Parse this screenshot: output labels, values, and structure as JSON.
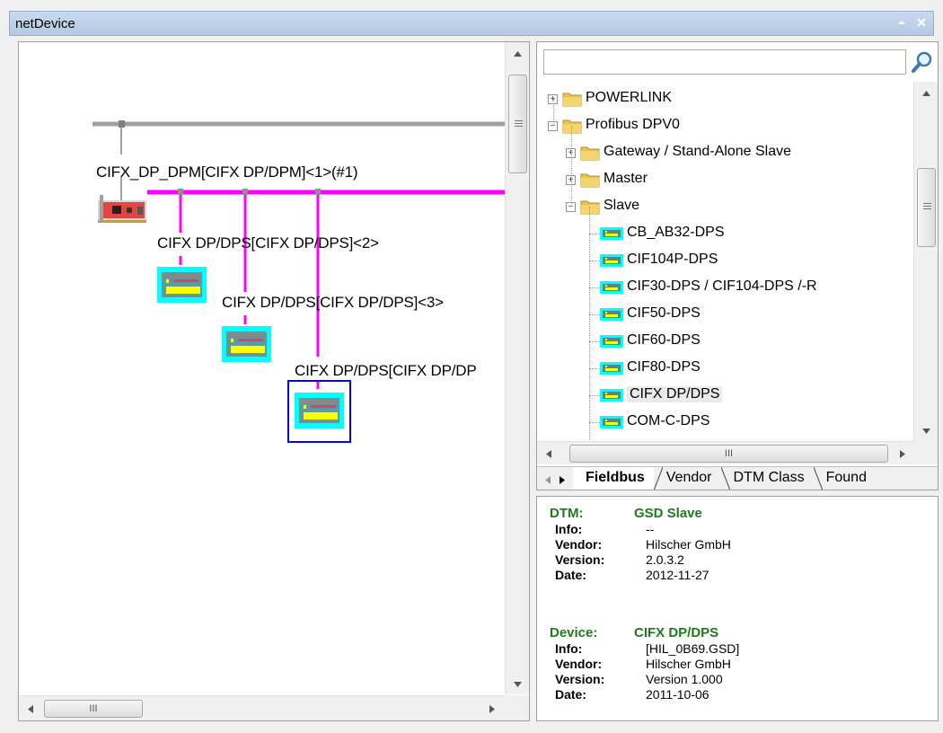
{
  "window": {
    "title": "netDevice"
  },
  "diagram": {
    "master_label": "CIFX_DP_DPM[CIFX DP/DPM]<1>(#1)",
    "slaves": [
      {
        "label": "CIFX DP/DPS[CIFX DP/DPS]<2>"
      },
      {
        "label": "CIFX DP/DPS[CIFX DP/DPS]<3>"
      },
      {
        "label": "CIFX DP/DPS[CIFX DP/DP"
      }
    ],
    "colors": {
      "bus_gray": "#a0a0a0",
      "bus_magenta": "#ff00ff",
      "device_cyan": "#00ffff",
      "selection_blue": "#0000ff"
    }
  },
  "scrollbars": {
    "h_grip": "III"
  },
  "catalog": {
    "search_value": "",
    "search_icon": "magnifier-icon",
    "tree": [
      {
        "label": "POWERLINK",
        "type": "folder",
        "level": 0,
        "expander": "+"
      },
      {
        "label": "Profibus DPV0",
        "type": "folder",
        "level": 0,
        "expander": "-"
      },
      {
        "label": "Gateway / Stand-Alone Slave",
        "type": "folder",
        "level": 1,
        "expander": "+"
      },
      {
        "label": "Master",
        "type": "folder",
        "level": 1,
        "expander": "+"
      },
      {
        "label": "Slave",
        "type": "folder",
        "level": 1,
        "expander": "-"
      },
      {
        "label": "CB_AB32-DPS",
        "type": "device",
        "level": 2
      },
      {
        "label": "CIF104P-DPS",
        "type": "device",
        "level": 2
      },
      {
        "label": "CIF30-DPS / CIF104-DPS /-R",
        "type": "device",
        "level": 2
      },
      {
        "label": "CIF50-DPS",
        "type": "device",
        "level": 2
      },
      {
        "label": "CIF60-DPS",
        "type": "device",
        "level": 2
      },
      {
        "label": "CIF80-DPS",
        "type": "device",
        "level": 2
      },
      {
        "label": "CIFX DP/DPS",
        "type": "device",
        "level": 2,
        "selected": true
      },
      {
        "label": "COM-C-DPS",
        "type": "device",
        "level": 2
      }
    ],
    "tabs": [
      {
        "label": "Fieldbus",
        "active": true
      },
      {
        "label": "Vendor",
        "active": false
      },
      {
        "label": "DTM Class",
        "active": false
      },
      {
        "label": "Found",
        "active": false
      }
    ]
  },
  "info": {
    "dtm": {
      "head_key": "DTM:",
      "head_value": "GSD Slave",
      "rows": [
        {
          "k": "Info:",
          "v": "--"
        },
        {
          "k": "Vendor:",
          "v": "Hilscher GmbH"
        },
        {
          "k": "Version:",
          "v": "2.0.3.2"
        },
        {
          "k": "Date:",
          "v": "2012-11-27"
        }
      ]
    },
    "device": {
      "head_key": "Device:",
      "head_value": "CIFX DP/DPS",
      "rows": [
        {
          "k": "Info:",
          "v": "[HIL_0B69.GSD]"
        },
        {
          "k": "Vendor:",
          "v": "Hilscher GmbH"
        },
        {
          "k": "Version:",
          "v": "Version 1.000"
        },
        {
          "k": "Date:",
          "v": "2011-10-06"
        }
      ]
    },
    "heading_color": "#1f7a1f"
  }
}
